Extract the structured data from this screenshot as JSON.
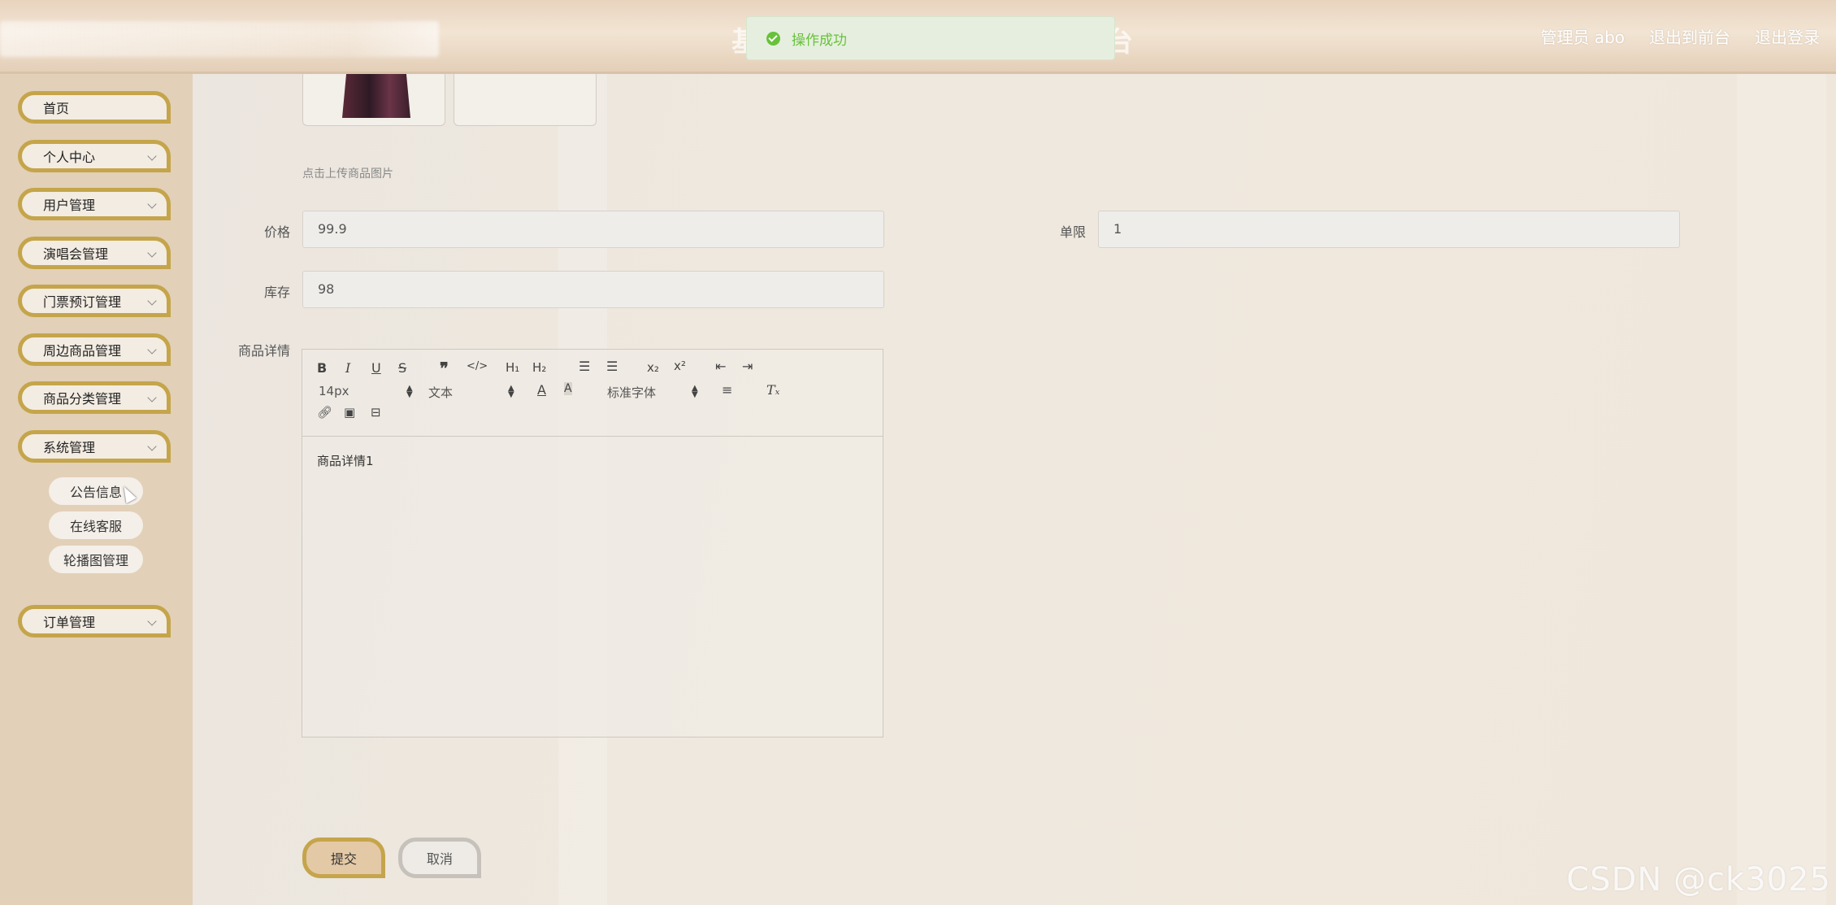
{
  "header": {
    "title_left": "基",
    "title_right": "台",
    "links": [
      "管理员 abo",
      "退出到前台",
      "退出登录"
    ]
  },
  "toast": {
    "message": "操作成功"
  },
  "sidebar": {
    "items": [
      {
        "label": "首页",
        "has_arrow": false
      },
      {
        "label": "个人中心",
        "has_arrow": true
      },
      {
        "label": "用户管理",
        "has_arrow": true
      },
      {
        "label": "演唱会管理",
        "has_arrow": true
      },
      {
        "label": "门票预订管理",
        "has_arrow": true
      },
      {
        "label": "周边商品管理",
        "has_arrow": true
      },
      {
        "label": "商品分类管理",
        "has_arrow": true
      },
      {
        "label": "系统管理",
        "has_arrow": true
      },
      {
        "label": "订单管理",
        "has_arrow": true
      }
    ],
    "sub_items": [
      "公告信息",
      "在线客服",
      "轮播图管理"
    ]
  },
  "form": {
    "upload_hint": "点击上传商品图片",
    "price": {
      "label": "价格",
      "value": "99.9"
    },
    "limit": {
      "label": "单限",
      "value": "1"
    },
    "stock": {
      "label": "库存",
      "value": "98"
    },
    "detail": {
      "label": "商品详情",
      "content": "商品详情1"
    }
  },
  "editor": {
    "font_size": "14px",
    "format": "文本",
    "font_family": "标准字体"
  },
  "buttons": {
    "submit": "提交",
    "cancel": "取消"
  },
  "watermark": "CSDN @ck3025",
  "colors": {
    "accent_border": "#c5a54b",
    "sidebar_bg": "#e2d0b8",
    "toast_text": "#67c23a"
  }
}
